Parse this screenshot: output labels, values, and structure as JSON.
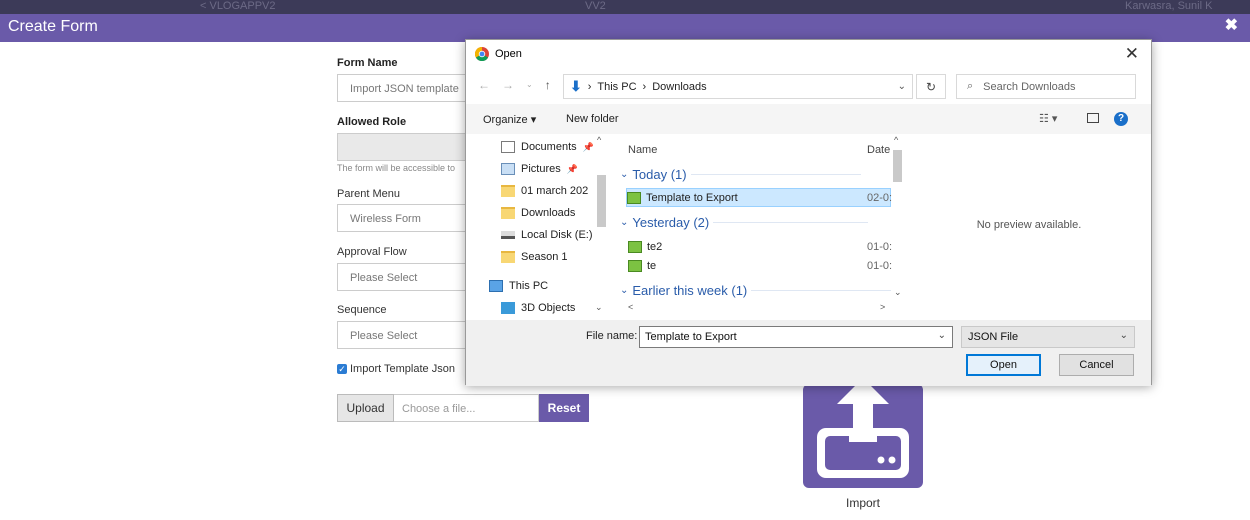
{
  "top_strip": {
    "left_text": "< VLOGAPPV2",
    "mid_text": "VV2",
    "right_text": "Karwasra, Sunil K"
  },
  "window": {
    "title": "Create Form",
    "close_glyph": "✖"
  },
  "form": {
    "form_name_label": "Form Name",
    "form_name_value": "Import JSON template",
    "allowed_role_label": "Allowed Role",
    "allowed_role_hint": "The form will be accessible to",
    "parent_menu_label": "Parent Menu",
    "parent_menu_value": "Wireless Form",
    "approval_flow_label": "Approval Flow",
    "approval_flow_value": "Please Select",
    "sequence_label": "Sequence",
    "sequence_value": "Please Select",
    "import_checkbox_label": "Import Template Json",
    "import_checked": true,
    "upload_label": "Upload",
    "file_placeholder": "Choose a file...",
    "reset_label": "Reset"
  },
  "import_tile": {
    "label": "Import",
    "color": "#6a5aa9"
  },
  "dialog": {
    "title": "Open",
    "close_glyph": "✕",
    "breadcrumb": [
      "This PC",
      "Downloads"
    ],
    "search_placeholder": "Search Downloads",
    "toolbar": {
      "organize": "Organize ▾",
      "new_folder": "New folder",
      "help": "?"
    },
    "nav_items": [
      {
        "label": "Documents",
        "icon": "document-icon",
        "pinned": true
      },
      {
        "label": "Pictures",
        "icon": "pictures-icon",
        "pinned": true
      },
      {
        "label": "01 march 202",
        "icon": "folder-icon",
        "pinned": false
      },
      {
        "label": "Downloads",
        "icon": "folder-icon",
        "pinned": false
      },
      {
        "label": "Local Disk (E:)",
        "icon": "disk-icon",
        "pinned": false
      },
      {
        "label": "Season 1",
        "icon": "folder-icon",
        "pinned": false
      },
      {
        "label": "This PC",
        "icon": "pc-icon",
        "pinned": false
      },
      {
        "label": "3D Objects",
        "icon": "cube-icon",
        "pinned": false
      }
    ],
    "columns": {
      "name": "Name",
      "date": "Date"
    },
    "groups": [
      {
        "label": "Today (1)",
        "files": [
          {
            "name": "Template to Export",
            "date": "02-0:",
            "selected": true
          }
        ]
      },
      {
        "label": "Yesterday (2)",
        "files": [
          {
            "name": "te2",
            "date": "01-0:",
            "selected": false
          },
          {
            "name": "te",
            "date": "01-0:",
            "selected": false
          }
        ]
      },
      {
        "label": "Earlier this week (1)",
        "files": []
      }
    ],
    "preview_text": "No preview available.",
    "file_name_label": "File name:",
    "file_name_value": "Template to Export",
    "file_type_value": "JSON File",
    "open_label": "Open",
    "cancel_label": "Cancel"
  }
}
